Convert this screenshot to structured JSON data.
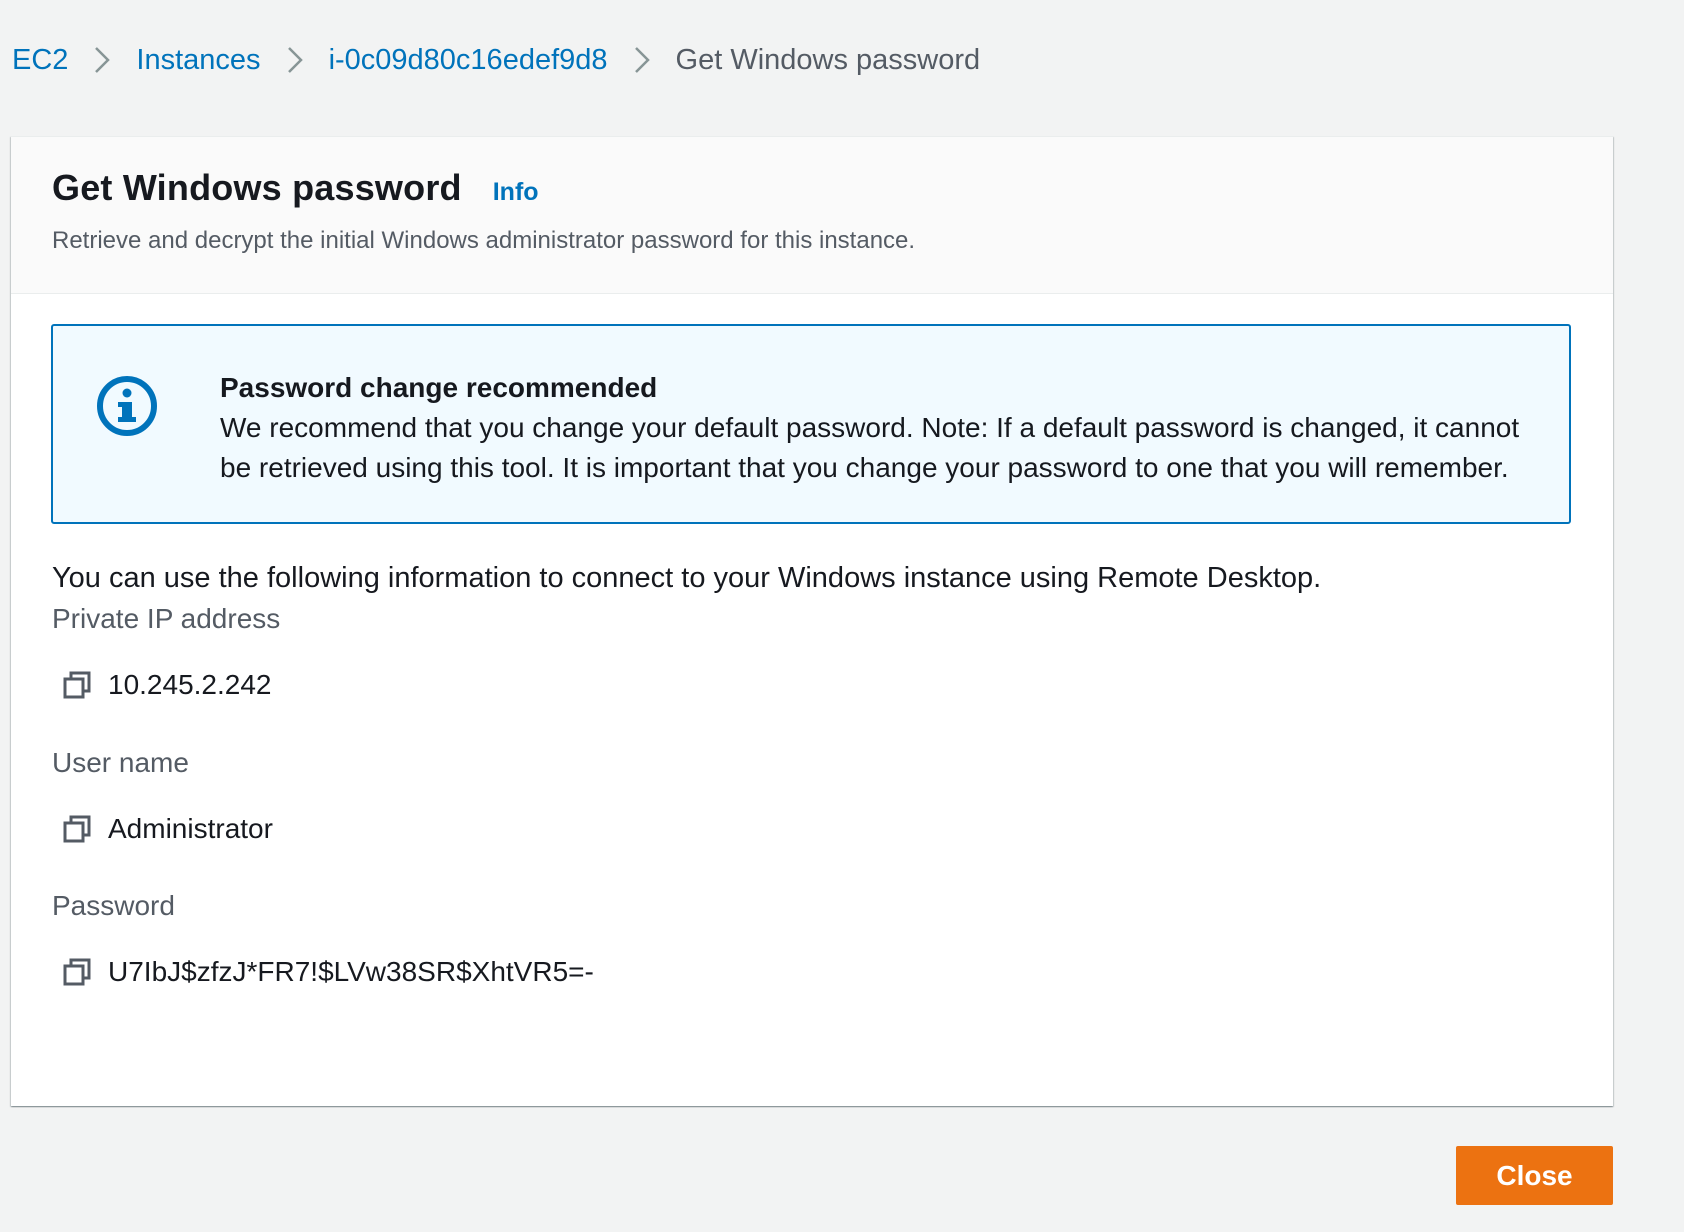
{
  "breadcrumb": {
    "items": [
      {
        "label": "EC2"
      },
      {
        "label": "Instances"
      },
      {
        "label": "i-0c09d80c16edef9d8"
      }
    ],
    "current": "Get Windows password"
  },
  "panel": {
    "title": "Get Windows password",
    "info_label": "Info",
    "subtitle": "Retrieve and decrypt the initial Windows administrator password for this instance."
  },
  "alert": {
    "icon": "info-circle-icon",
    "title": "Password change recommended",
    "body": "We recommend that you change your default password. Note: If a default password is changed, it cannot be retrieved using this tool. It is important that you change your password to one that you will remember."
  },
  "intro": "You can use the following information to connect to your Windows instance using Remote Desktop.",
  "fields": {
    "private_ip": {
      "label": "Private IP address",
      "value": "10.245.2.242",
      "icon": "copy-icon"
    },
    "user_name": {
      "label": "User name",
      "value": "Administrator",
      "icon": "copy-icon"
    },
    "password": {
      "label": "Password",
      "value": "U7IbJ$zfzJ*FR7!$LVw38SR$XhtVR5=-",
      "icon": "copy-icon"
    }
  },
  "actions": {
    "close_label": "Close"
  },
  "colors": {
    "link": "#0073bb",
    "primary_button": "#ec7211",
    "alert_border": "#0073bb",
    "alert_bg": "#f1faff",
    "page_bg": "#f2f3f3"
  }
}
